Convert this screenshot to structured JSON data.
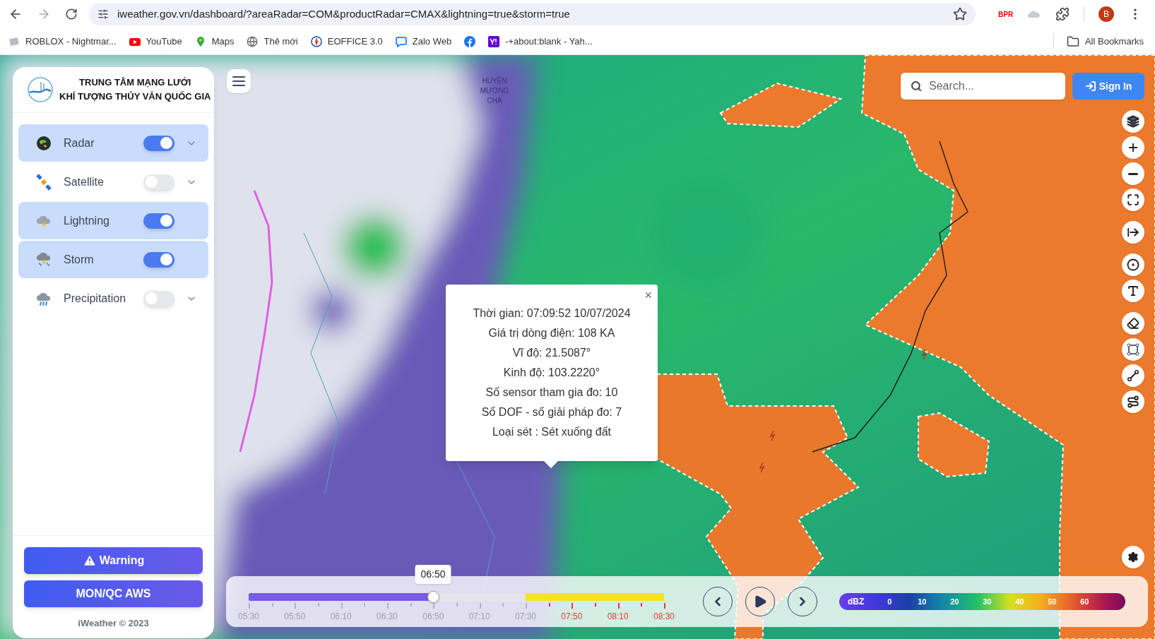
{
  "browser": {
    "url": "iweather.gov.vn/dashboard/?areaRadar=COM&productRadar=CMAX&lightning=true&storm=true",
    "extension_label": "BPR",
    "profile_initial": "B",
    "bookmarks": [
      {
        "kind": "labeled",
        "label": "ROBLOX - Nightmar..."
      },
      {
        "kind": "labeled",
        "label": "YouTube"
      },
      {
        "kind": "labeled",
        "label": "Maps"
      },
      {
        "kind": "labeled",
        "label": "Thẻ mới"
      },
      {
        "kind": "labeled",
        "label": "EOFFICE 3.0"
      },
      {
        "kind": "labeled",
        "label": "Zalo Web"
      },
      {
        "kind": "icon_only"
      },
      {
        "kind": "labeled",
        "label": "-+about:blank - Yah..."
      }
    ],
    "all_bookmarks": "All Bookmarks"
  },
  "map": {
    "place_label": "HUYỆN MƯỜNG CHÀ"
  },
  "sidebar": {
    "title_lines": [
      "TRUNG TÂM MẠNG LƯỚI",
      "KHÍ TƯỢNG THỦY VĂN QUỐC GIA"
    ],
    "layers": [
      {
        "label": "Radar",
        "on": true,
        "expandable": true
      },
      {
        "label": "Satellite",
        "on": false,
        "expandable": true
      },
      {
        "label": "Lightning",
        "on": true,
        "expandable": false
      },
      {
        "label": "Storm",
        "on": true,
        "expandable": false
      },
      {
        "label": "Precipitation",
        "on": false,
        "expandable": true
      }
    ],
    "buttons": [
      {
        "label": "Warning",
        "kind": "warning"
      },
      {
        "label": "MON/QC AWS",
        "kind": "plain"
      }
    ],
    "footer": "iWeather © 2023"
  },
  "search": {
    "placeholder": "Search..."
  },
  "sign_in": "Sign In",
  "popup": {
    "close": "×",
    "lines": [
      "Thời gian: 07:09:52 10/07/2024",
      "Giá trị dòng điện: 108 KA",
      "Vĩ độ: 21.5087°",
      "Kinh độ: 103.2220°",
      "Số sensor tham gia đo: 10",
      "Số DOF - số giải pháp đo: 7",
      "Loại sét : Sét xuống đất"
    ]
  },
  "timeline": {
    "tooltip": "06:50",
    "level": 0.444,
    "labels": [
      {
        "text": "05:30",
        "forecast": false
      },
      {
        "text": "05:50",
        "forecast": false
      },
      {
        "text": "06:10",
        "forecast": false
      },
      {
        "text": "06:30",
        "forecast": false
      },
      {
        "text": "06:50",
        "forecast": false
      },
      {
        "text": "07:10",
        "forecast": false
      },
      {
        "text": "07:30",
        "forecast": false
      },
      {
        "text": "07:50",
        "forecast": true
      },
      {
        "text": "08:10",
        "forecast": true
      },
      {
        "text": "08:30",
        "forecast": true
      }
    ]
  },
  "legend": {
    "unit": "dBZ",
    "values": [
      "0",
      "10",
      "20",
      "30",
      "40",
      "50",
      "60"
    ]
  }
}
